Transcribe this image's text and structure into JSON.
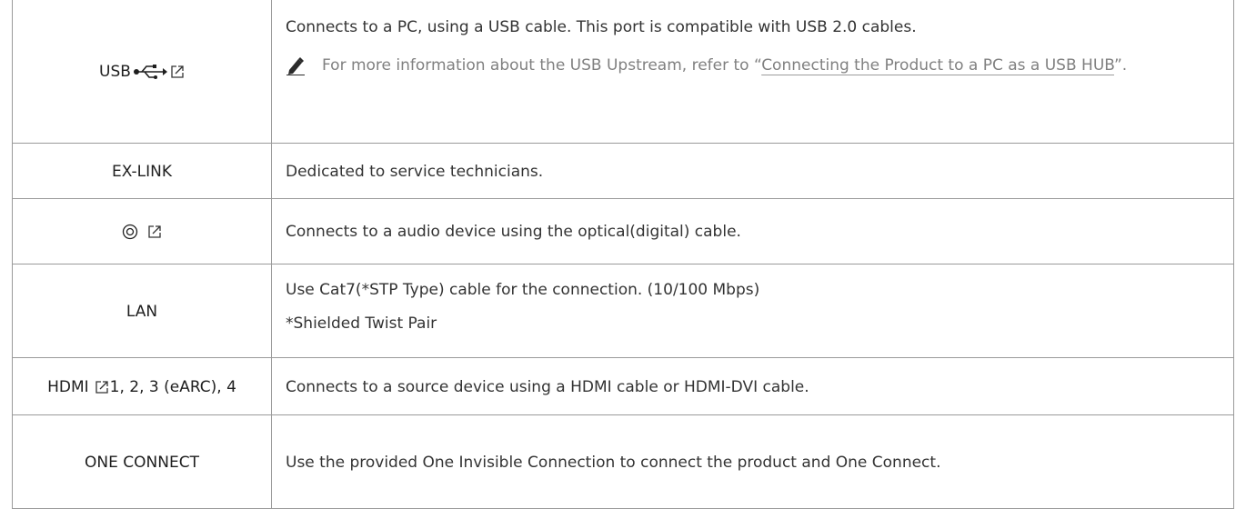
{
  "rows": [
    {
      "port": "USB",
      "desc": "Connects to a PC, using a USB cable. This port is compatible with USB 2.0 cables.",
      "note_prefix": "For more information about the USB Upstream, refer to “",
      "note_link": "Connecting the Product to a PC as a USB HUB",
      "note_suffix": "”."
    },
    {
      "port": "EX-LINK",
      "desc": "Dedicated to service technicians."
    },
    {
      "port": "",
      "desc": "Connects to a audio device using the optical(digital) cable."
    },
    {
      "port": "LAN",
      "desc": "Use Cat7(*STP Type) cable for the connection. (10/100 Mbps)",
      "desc2": "*Shielded Twist Pair"
    },
    {
      "port_prefix": "HDMI",
      "port_suffix": "1, 2, 3 (eARC), 4",
      "desc": "Connects to a source device using a HDMI cable or HDMI-DVI cable."
    },
    {
      "port": "ONE CONNECT",
      "desc": "Use the provided One Invisible Connection to connect the product and One Connect."
    }
  ],
  "icons": [
    "usb-icon",
    "external-link-icon",
    "pencil-note-icon",
    "optical-port-icon",
    "hdmi-port-icon"
  ]
}
